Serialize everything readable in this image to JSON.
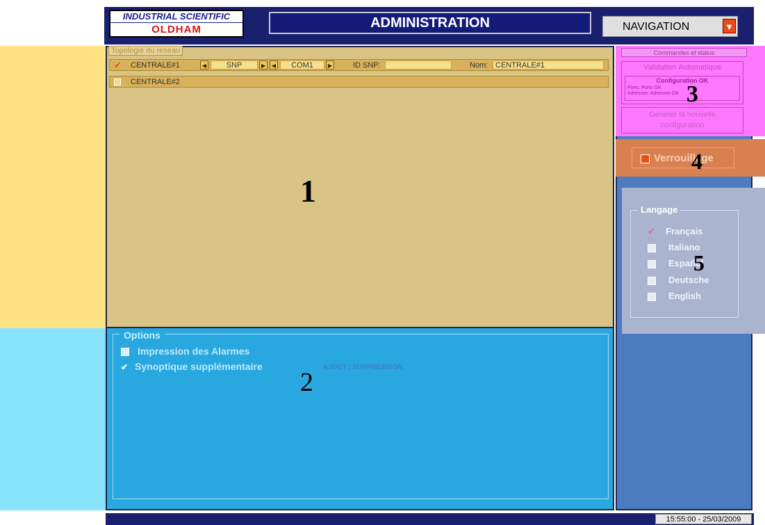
{
  "header": {
    "logo_line1": "INDUSTRIAL SCIENTIFIC",
    "logo_line2": "OLDHAM",
    "title": "ADMINISTRATION",
    "navigation_label": "NAVIGATION",
    "navigation_icon": "down-arrow-icon"
  },
  "topology": {
    "label": "Topologie du reseau",
    "rows": [
      {
        "checked": true,
        "name": "CENTRALE#1",
        "protocol": "SNP",
        "port": "COM1",
        "id_label": "ID SNP:",
        "id_value": "",
        "nom_label": "Nom:",
        "nom_value": "CENTRALE#1"
      },
      {
        "checked": false,
        "name": "CENTRALE#2"
      }
    ]
  },
  "options": {
    "legend": "Options",
    "items": [
      {
        "label": "Impression des Alarmes",
        "checked": false
      },
      {
        "label": "Synoptique supplémentaire",
        "checked": true
      }
    ],
    "ajout_link": "AJOUT / SUPPRESSION"
  },
  "commands": {
    "title": "Commandes et status",
    "validation_label": "Validation Automatique",
    "config_status": "Configuration OK",
    "ports_line": "Ports:  Ports OK",
    "addresses_line": "Adresses:  Adresses OK",
    "generate_line1": "Generer la nouvelle",
    "generate_line2": "configuration"
  },
  "lock": {
    "label": "Verrouillage",
    "checked": true
  },
  "language": {
    "legend": "Langage",
    "options": [
      {
        "label": "Français",
        "checked": true
      },
      {
        "label": "Italiano",
        "checked": false
      },
      {
        "label": "Español",
        "checked": false
      },
      {
        "label": "Deutsche",
        "checked": false
      },
      {
        "label": "English",
        "checked": false
      }
    ]
  },
  "callouts": [
    "1",
    "2",
    "3",
    "4",
    "5"
  ],
  "footer": {
    "clock": "15:55:00  -  25/03/2009"
  },
  "colors": {
    "zone1": "#d9c486",
    "zone2": "#29a8e0",
    "zone3": "#ff76ff",
    "zone4": "#d88050",
    "zone5": "#aab4cf",
    "frame": "#1a1f6e"
  }
}
